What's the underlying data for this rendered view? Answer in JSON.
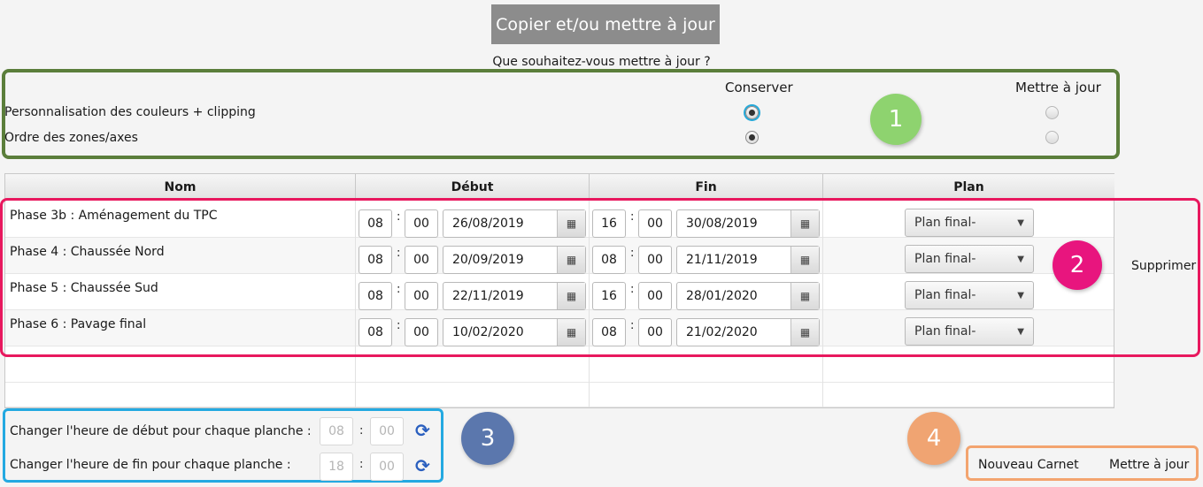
{
  "header": {
    "title": "Copier et/ou mettre à jour",
    "question": "Que souhaitez-vous mettre à jour ?"
  },
  "options": {
    "col_keep": "Conserver",
    "col_update": "Mettre à jour",
    "rows": [
      {
        "label": "Personnalisation des couleurs  + clipping",
        "selected": "keep"
      },
      {
        "label": "Ordre des zones/axes",
        "selected": "keep"
      }
    ]
  },
  "badges": [
    "1",
    "2",
    "3",
    "4"
  ],
  "badge_colors": {
    "1": "#8ed36f",
    "2": "#e8157e",
    "3": "#5b77ad",
    "4": "#f0a472"
  },
  "table": {
    "headers": {
      "name": "Nom",
      "start": "Début",
      "end": "Fin",
      "plan": "Plan"
    },
    "rows": [
      {
        "name": "Phase 3b : Aménagement du TPC",
        "start_h": "08",
        "start_m": "00",
        "start_date": "26/08/2019",
        "end_h": "16",
        "end_m": "00",
        "end_date": "30/08/2019",
        "plan": "Plan final-"
      },
      {
        "name": "Phase 4 : Chaussée Nord",
        "start_h": "08",
        "start_m": "00",
        "start_date": "20/09/2019",
        "end_h": "08",
        "end_m": "00",
        "end_date": "21/11/2019",
        "plan": "Plan final-"
      },
      {
        "name": "Phase 5 : Chaussée Sud",
        "start_h": "08",
        "start_m": "00",
        "start_date": "22/11/2019",
        "end_h": "16",
        "end_m": "00",
        "end_date": "28/01/2020",
        "plan": "Plan final-"
      },
      {
        "name": "Phase 6 : Pavage final",
        "start_h": "08",
        "start_m": "00",
        "start_date": "10/02/2020",
        "end_h": "08",
        "end_m": "00",
        "end_date": "21/02/2020",
        "plan": "Plan final-"
      }
    ],
    "colon": ":"
  },
  "delete_label": "Supprimer",
  "hours": {
    "start_label": "Changer l'heure de début pour chaque planche :",
    "start_h": "08",
    "start_m": "00",
    "end_label": "Changer l'heure de fin pour chaque planche :",
    "end_h": "18",
    "end_m": "00"
  },
  "footer": {
    "new_notebook": "Nouveau Carnet",
    "update": "Mettre à jour"
  },
  "icons": {
    "calendar": "calendar-icon",
    "refresh": "refresh-icon",
    "dropdown": "chevron-down-icon"
  }
}
